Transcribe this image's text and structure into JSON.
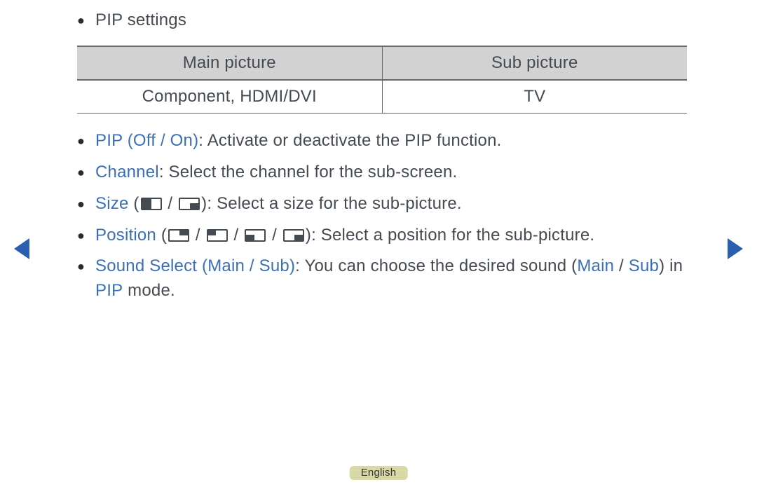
{
  "title": "PIP settings",
  "table": {
    "head": {
      "main": "Main picture",
      "sub": "Sub picture"
    },
    "row": {
      "main": "Component, HDMI/DVI",
      "sub": "TV"
    }
  },
  "items": {
    "pip": {
      "label": "PIP (Off / On)",
      "text": ": Activate or deactivate the PIP function."
    },
    "channel": {
      "label": "Channel",
      "text": ": Select the channel for the sub-screen."
    },
    "size": {
      "label": "Size",
      "text": "): Select a size for the sub-picture."
    },
    "position": {
      "label": "Position",
      "text": "): Select a position for the sub-picture."
    },
    "sound": {
      "label": "Sound Select (Main / Sub)",
      "pre": ": You can choose the desired sound (",
      "main": "Main",
      "sep": " / ",
      "sub": "Sub",
      "post1": ") in ",
      "pip": "PIP",
      "post2": " mode."
    }
  },
  "glyphs": {
    "slash": " / ",
    "open": " (",
    "bullet": "●"
  },
  "lang": "English"
}
